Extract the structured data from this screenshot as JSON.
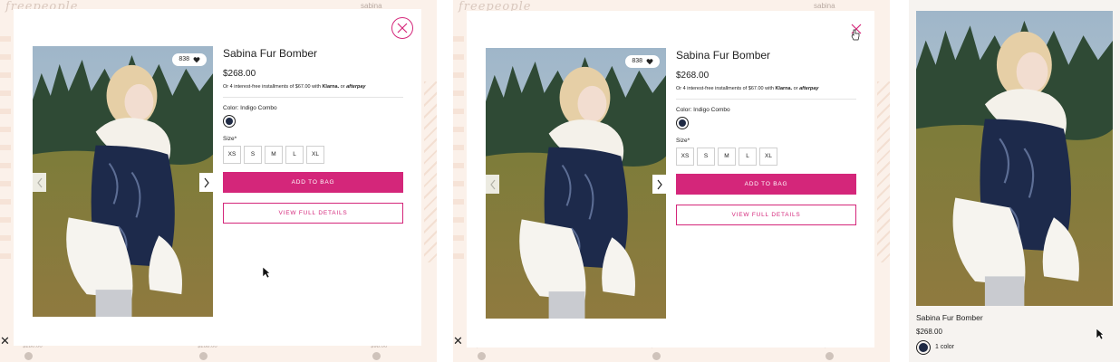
{
  "background": {
    "top_label": "sabina",
    "bottom_prices": [
      "$280.00",
      "$268.00",
      "$98.00"
    ]
  },
  "product": {
    "title": "Sabina Fur Bomber",
    "price": "$268.00",
    "installments_prefix": "Or 4 interest-free installments of $67.00 with",
    "klarna": "Klarna.",
    "installments_or": "or",
    "afterpay": "afterpay",
    "color_label": "Color: Indigo Combo",
    "size_label": "Size*",
    "sizes": [
      "XS",
      "S",
      "M",
      "L",
      "XL"
    ],
    "favorites_count": "838",
    "add_to_bag": "ADD TO BAG",
    "view_full_details": "VIEW FULL DETAILS"
  },
  "card": {
    "name": "Sabina Fur Bomber",
    "price": "$268.00",
    "colors": "1 color"
  },
  "colors": {
    "accent": "#d4267a",
    "swatch": "#1f2a44",
    "background_tint": "#fbf1ea"
  },
  "icons": {
    "close": "close-icon",
    "heart": "heart-icon",
    "prev": "chevron-left-icon",
    "next": "chevron-right-icon",
    "cursor": "mouse-pointer-icon",
    "hand": "hand-pointer-icon"
  }
}
